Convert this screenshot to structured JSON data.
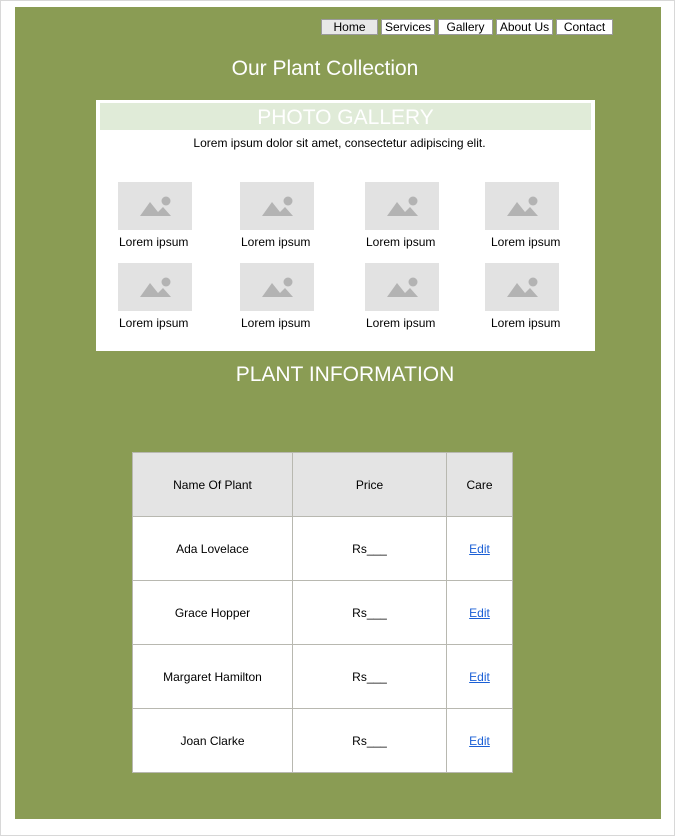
{
  "nav": {
    "items": [
      "Home",
      "Services",
      "Gallery",
      "About Us",
      "Contact"
    ],
    "active": "Home"
  },
  "page_title": "Our Plant Collection",
  "gallery": {
    "heading": "PHOTO GALLERY",
    "subtitle": "Lorem ipsum dolor sit amet, consectetur adipiscing elit.",
    "items": [
      {
        "caption": "Lorem ipsum",
        "icon": "image-placeholder-icon"
      },
      {
        "caption": "Lorem ipsum",
        "icon": "image-placeholder-icon"
      },
      {
        "caption": "Lorem ipsum",
        "icon": "image-placeholder-icon"
      },
      {
        "caption": "Lorem ipsum",
        "icon": "image-placeholder-icon"
      },
      {
        "caption": "Lorem ipsum",
        "icon": "image-placeholder-icon"
      },
      {
        "caption": "Lorem ipsum",
        "icon": "image-placeholder-icon"
      },
      {
        "caption": "Lorem ipsum",
        "icon": "image-placeholder-icon"
      },
      {
        "caption": "Lorem ipsum",
        "icon": "image-placeholder-icon"
      }
    ]
  },
  "plant_info": {
    "heading": "PLANT INFORMATION",
    "columns": [
      "Name Of Plant",
      "Price",
      "Care"
    ],
    "rows": [
      {
        "name": "Ada Lovelace",
        "price": "Rs___",
        "care": "Edit"
      },
      {
        "name": "Grace Hopper",
        "price": "Rs___",
        "care": "Edit"
      },
      {
        "name": "Margaret Hamilton",
        "price": "Rs___",
        "care": "Edit"
      },
      {
        "name": "Joan Clarke",
        "price": "Rs___",
        "care": "Edit"
      }
    ]
  },
  "colors": {
    "panel": "#8a9c54",
    "gallery_head": "#e0ebd8",
    "table_header": "#e4e4e4",
    "link": "#1a5fd6"
  }
}
